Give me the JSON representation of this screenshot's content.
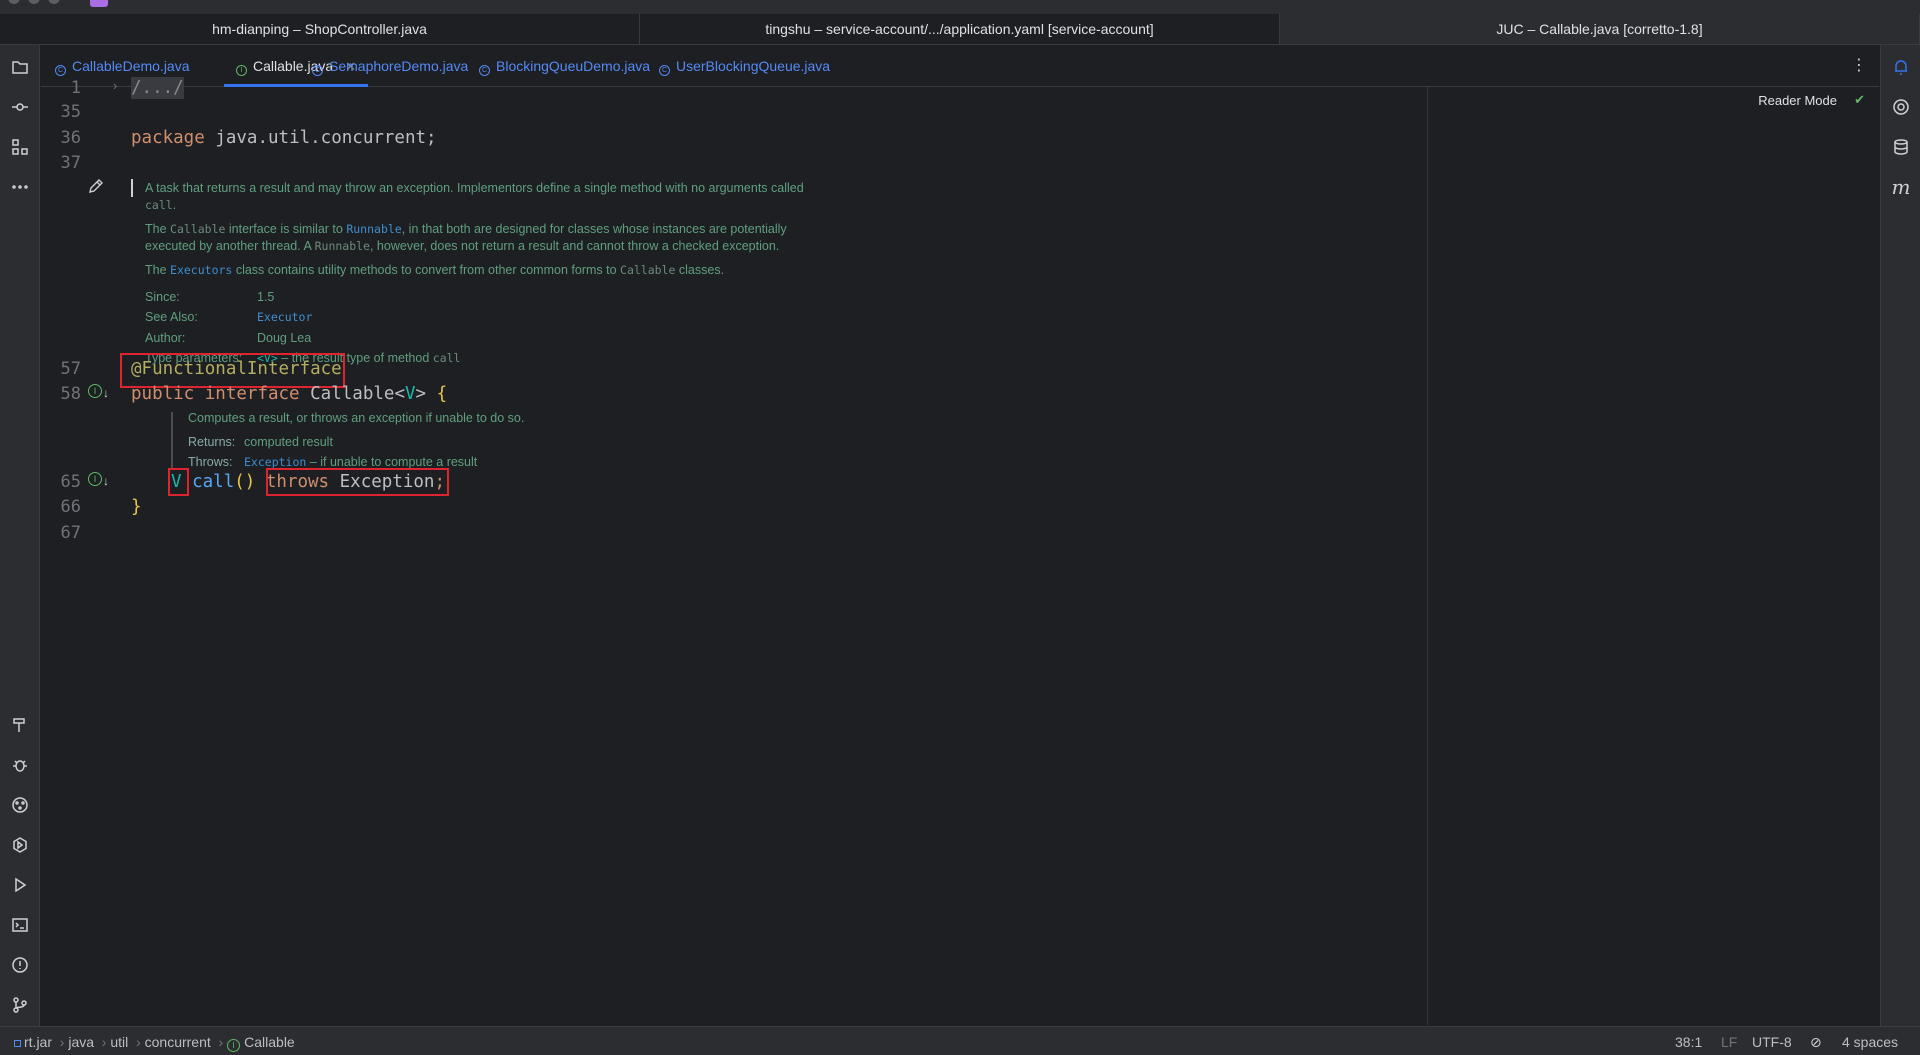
{
  "window_tabs": [
    "hm-dianping – ShopController.java",
    "tingshu – service-account/.../application.yaml [service-account]",
    "JUC – Callable.java [corretto-1.8]"
  ],
  "editor_tabs": [
    {
      "label": "CallableDemo.java",
      "icon": "class-icon"
    },
    {
      "label": "Callable.java",
      "icon": "interface-icon",
      "active": true
    },
    {
      "label": "SemaphoreDemo.java",
      "icon": "class-icon"
    },
    {
      "label": "BlockingQueuDemo.java",
      "icon": "class-icon"
    },
    {
      "label": "UserBlockingQueue.java",
      "icon": "class-icon"
    }
  ],
  "editor": {
    "reader_mode": "Reader Mode",
    "line_numbers": [
      "1",
      "35",
      "36",
      "37",
      "57",
      "58",
      "65",
      "66",
      "67"
    ],
    "folded": "/.../",
    "package_kw": "package",
    "package_name": "java.util.concurrent;",
    "annotation": "@FunctionalInterface",
    "decl_public": "public",
    "decl_interface": "interface",
    "decl_name": "Callable",
    "decl_lt": "<",
    "decl_v": "V",
    "decl_gt": ">",
    "decl_brace": "{",
    "m_type": "V",
    "m_name": "call",
    "m_parens": "()",
    "m_throws": "throws",
    "m_exc": "Exception",
    "m_semi": ";",
    "close_brace": "}"
  },
  "javadoc_class": {
    "p1": "A task that returns a result and may throw an exception. Implementors define a single method with no arguments called",
    "p1_code": "call",
    "p1_end": ".",
    "p2a": "The",
    "p2_code1": "Callable",
    "p2b": "interface is similar to",
    "p2_link": "Runnable",
    "p2c": ", in that both are designed for classes whose instances are potentially executed by another thread. A",
    "p2_code2": "Runnable",
    "p2d": ", however, does not return a result and cannot throw a checked exception.",
    "p3a": "The",
    "p3_link": "Executors",
    "p3b": "class contains utility methods to convert from other common forms to",
    "p3_code": "Callable",
    "p3c": "classes.",
    "since_label": "Since:",
    "since_value": "1.5",
    "see_label": "See Also:",
    "see_value": "Executor",
    "author_label": "Author:",
    "author_value": "Doug Lea",
    "tparam_label": "Type parameters:",
    "tparam_code": "<V>",
    "tparam_text": "– the result type of method",
    "tparam_code2": "call"
  },
  "javadoc_method": {
    "desc": "Computes a result, or throws an exception if unable to do so.",
    "returns_label": "Returns:",
    "returns_value": "computed result",
    "throws_label": "Throws:",
    "throws_link": "Exception",
    "throws_text": "– if unable to compute a result"
  },
  "status": {
    "crumbs": [
      "rt.jar",
      "java",
      "util",
      "concurrent",
      "Callable"
    ],
    "position": "38:1",
    "line_sep": "LF",
    "encoding": "UTF-8",
    "indent": "4 spaces"
  },
  "colors": {
    "background": "#1e1f22",
    "keyword": "#cf8e6d",
    "annotation": "#b3ae60",
    "type_param": "#16baac",
    "method": "#56a8f5",
    "highlight_box": "#e0242f",
    "javadoc": "#5f9f80"
  }
}
